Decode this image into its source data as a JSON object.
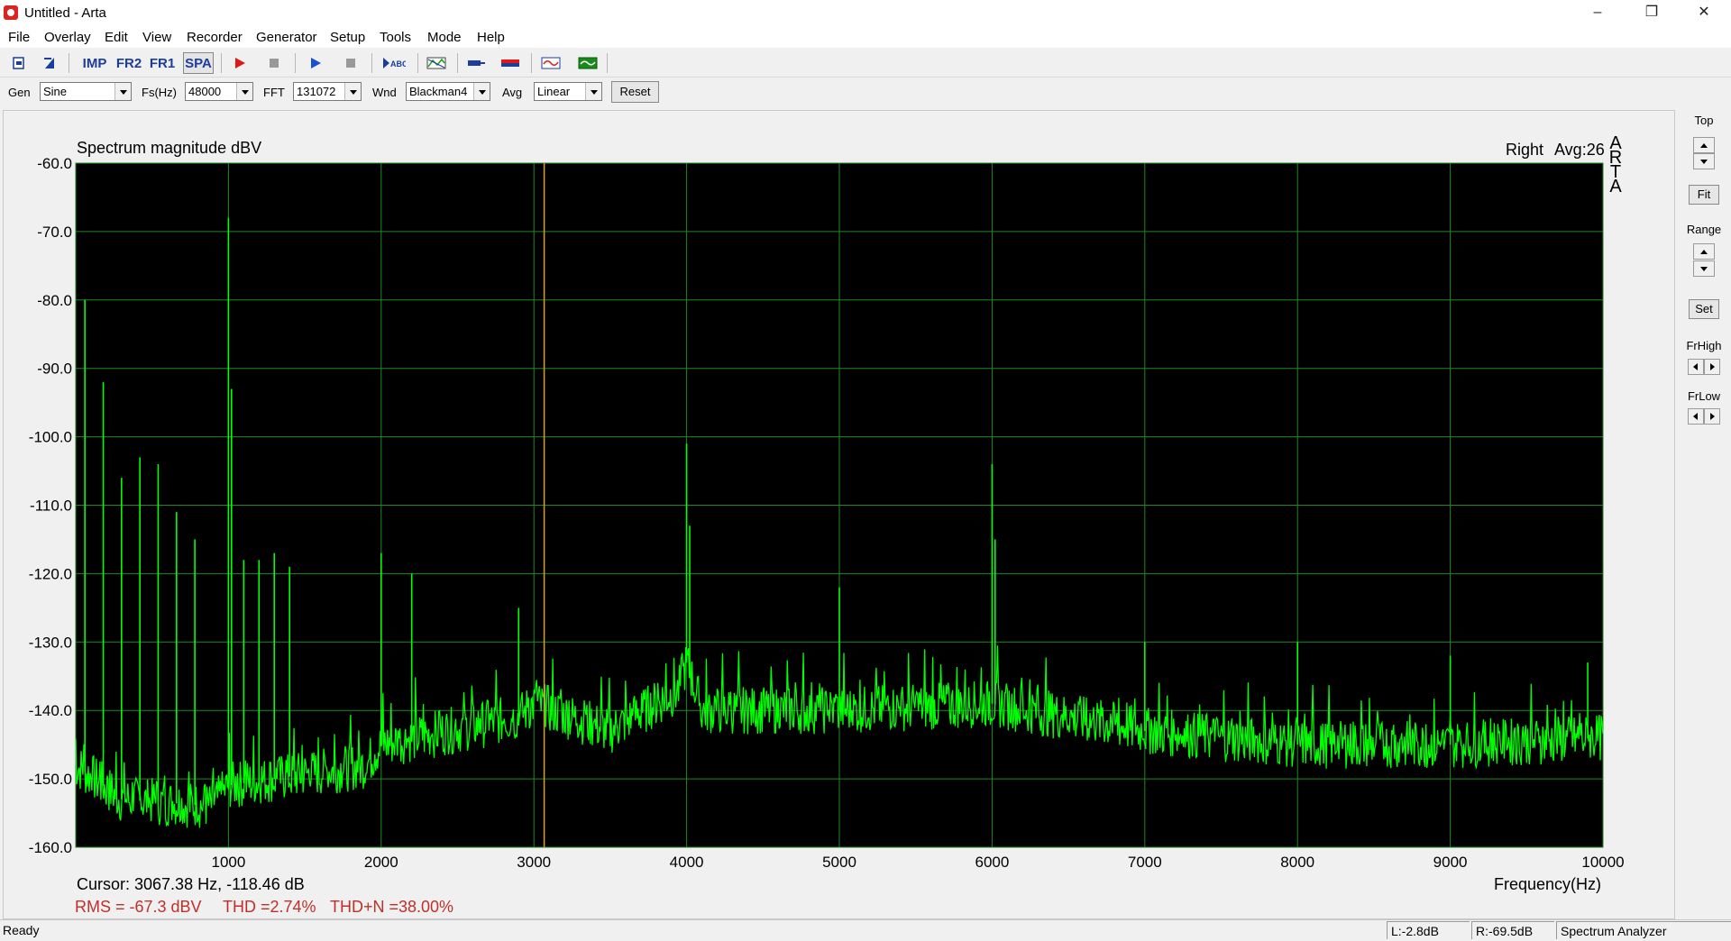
{
  "window": {
    "title": "Untitled - Arta",
    "minimize": "–",
    "restore": "❐",
    "close": "✕"
  },
  "menu": [
    "File",
    "Overlay",
    "Edit",
    "View",
    "Recorder",
    "Generator",
    "Setup",
    "Tools",
    "Mode",
    "Help"
  ],
  "toolbar": {
    "imp": "IMP",
    "fr2": "FR2",
    "fr1": "FR1",
    "spa": "SPA",
    "icons": [
      "new-file-icon",
      "open-file-icon",
      "record-icon",
      "stop-icon",
      "play-icon",
      "stop2-icon",
      "abc-icon",
      "overlay-icon",
      "probe-icon",
      "level-icon",
      "scope-icon",
      "meter-icon"
    ]
  },
  "controls": {
    "gen_label": "Gen",
    "gen_value": "Sine",
    "fs_label": "Fs(Hz)",
    "fs_value": "48000",
    "fft_label": "FFT",
    "fft_value": "131072",
    "wnd_label": "Wnd",
    "wnd_value": "Blackman4",
    "avg_label": "Avg",
    "avg_value": "Linear",
    "reset_label": "Reset"
  },
  "chart_header": {
    "title": "Spectrum magnitude dBV",
    "channel": "Right",
    "avg": "Avg:26",
    "watermark": "ARTA"
  },
  "readouts": {
    "cursor": "Cursor: 3067.38 Hz, -118.46 dB",
    "rms": "RMS =  -67.3 dBV",
    "thd": "THD =2.74%",
    "thdn": "THD+N =38.00%",
    "xaxis_label": "Frequency(Hz)"
  },
  "side_panel": {
    "top": "Top",
    "fit": "Fit",
    "range": "Range",
    "set": "Set",
    "frhigh": "FrHigh",
    "frlow": "FrLow"
  },
  "status": {
    "ready": "Ready",
    "left": "L:-2.8dB",
    "right": "R:-69.5dB",
    "mode": "Spectrum Analyzer"
  },
  "colors": {
    "trace": "#00ff00",
    "grid": "#1f8a1f",
    "cursor": "#d8a400",
    "plot_bg": "#000000",
    "readout_red": "#c0302a"
  },
  "chart_data": {
    "type": "line",
    "title": "Spectrum magnitude dBV",
    "xlabel": "Frequency(Hz)",
    "ylabel": "",
    "xlim": [
      0,
      10000
    ],
    "ylim": [
      -160,
      -60
    ],
    "x_ticks": [
      1000,
      2000,
      3000,
      4000,
      5000,
      6000,
      7000,
      8000,
      9000,
      10000
    ],
    "y_ticks": [
      "-60.0",
      "-70.0",
      "-80.0",
      "-90.0",
      "-100.0",
      "-110.0",
      "-120.0",
      "-130.0",
      "-140.0",
      "-150.0",
      "-160.0"
    ],
    "grid": true,
    "cursor_hz": 3067.38,
    "cursor_db": -118.46,
    "noise_floor": [
      [
        0,
        -148
      ],
      [
        300,
        -153
      ],
      [
        900,
        -154
      ],
      [
        1000,
        -151
      ],
      [
        1900,
        -148
      ],
      [
        2000,
        -145
      ],
      [
        2900,
        -141
      ],
      [
        3000,
        -139
      ],
      [
        3500,
        -143
      ],
      [
        3950,
        -137
      ],
      [
        4000,
        -133
      ],
      [
        4100,
        -140
      ],
      [
        5000,
        -140
      ],
      [
        6000,
        -139
      ],
      [
        7000,
        -143
      ],
      [
        8000,
        -145
      ],
      [
        9000,
        -145
      ],
      [
        10000,
        -144
      ]
    ],
    "peaks": [
      [
        60,
        -80
      ],
      [
        180,
        -92
      ],
      [
        300,
        -106
      ],
      [
        420,
        -103
      ],
      [
        540,
        -104
      ],
      [
        660,
        -111
      ],
      [
        780,
        -115
      ],
      [
        1000,
        -68
      ],
      [
        1020,
        -93
      ],
      [
        1100,
        -118
      ],
      [
        1200,
        -118
      ],
      [
        1300,
        -117
      ],
      [
        1400,
        -119
      ],
      [
        2000,
        -117
      ],
      [
        2200,
        -120
      ],
      [
        2900,
        -125
      ],
      [
        4000,
        -101
      ],
      [
        4020,
        -113
      ],
      [
        5000,
        -122
      ],
      [
        6000,
        -104
      ],
      [
        6020,
        -115
      ],
      [
        7000,
        -130
      ],
      [
        8000,
        -130
      ],
      [
        9000,
        -132
      ],
      [
        9900,
        -133
      ]
    ]
  }
}
